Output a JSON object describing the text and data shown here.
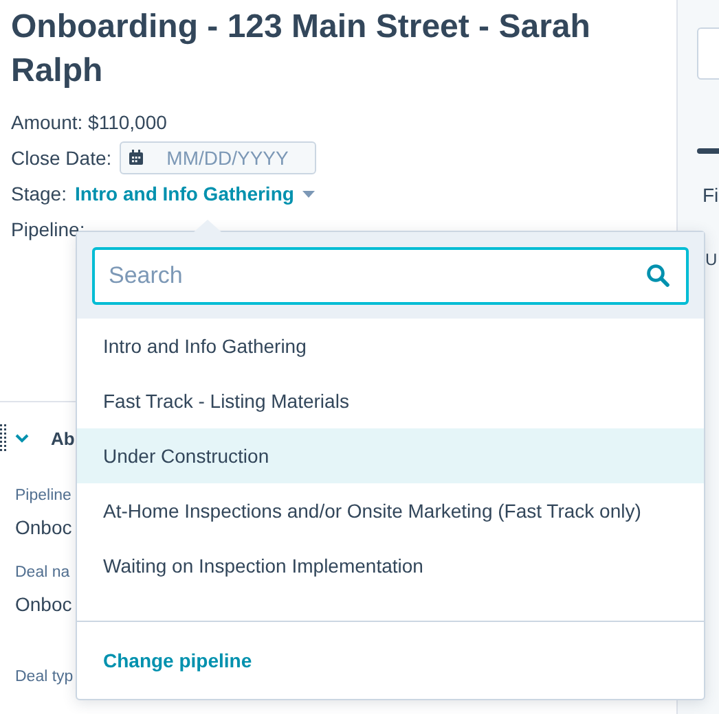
{
  "record": {
    "title": "Onboarding - 123 Main Street - Sarah Ralph",
    "amount": {
      "label": "Amount:",
      "value": "$110,000"
    },
    "close_date": {
      "label": "Close Date:",
      "placeholder": "MM/DD/YYYY"
    },
    "stage": {
      "label": "Stage:",
      "value": "Intro and Info Gathering"
    },
    "pipeline": {
      "label": "Pipeline:"
    }
  },
  "section": {
    "title": "Ab",
    "expanded": true,
    "fields": [
      {
        "label": "Pipeline",
        "value": "Onboc"
      },
      {
        "label": "Deal na",
        "value": "Onboc"
      },
      {
        "label": "Deal typ"
      }
    ]
  },
  "sidebar": {
    "texts": [
      "Fi",
      "U"
    ]
  },
  "stage_menu": {
    "search": {
      "placeholder": "Search"
    },
    "options": [
      {
        "label": "Intro and Info Gathering",
        "selected": false
      },
      {
        "label": "Fast Track - Listing Materials",
        "selected": false
      },
      {
        "label": "Under Construction",
        "selected": true
      },
      {
        "label": "At-Home Inspections and/or Onsite Marketing (Fast Track only)",
        "selected": false
      },
      {
        "label": "Waiting on Inspection Implementation",
        "selected": false
      }
    ],
    "footer_link": "Change pipeline"
  }
}
